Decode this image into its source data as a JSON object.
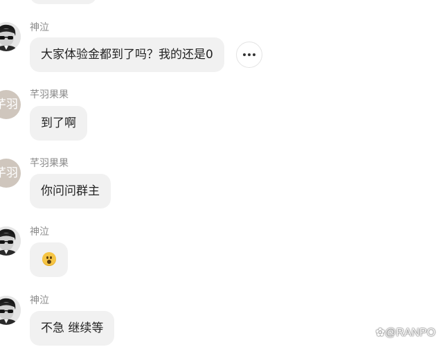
{
  "messages": [
    {
      "sender": "神泣",
      "avatar": "photo",
      "text": "大家体验金都到了吗？我的还是0",
      "has_more": true
    },
    {
      "sender": "芊羽果果",
      "avatar": "芊羽",
      "text": "到了啊"
    },
    {
      "sender": "芊羽果果",
      "avatar": "芊羽",
      "text": "你问问群主"
    },
    {
      "sender": "神泣",
      "avatar": "photo",
      "text": "",
      "emoji": "astonished-face"
    },
    {
      "sender": "神泣",
      "avatar": "photo",
      "text": "不急 继续等"
    }
  ],
  "watermark": "@RANPO",
  "colors": {
    "bubble": "#f1f1f1",
    "sender": "#8a8a8a",
    "text_avatar": "#cfc6bd"
  }
}
